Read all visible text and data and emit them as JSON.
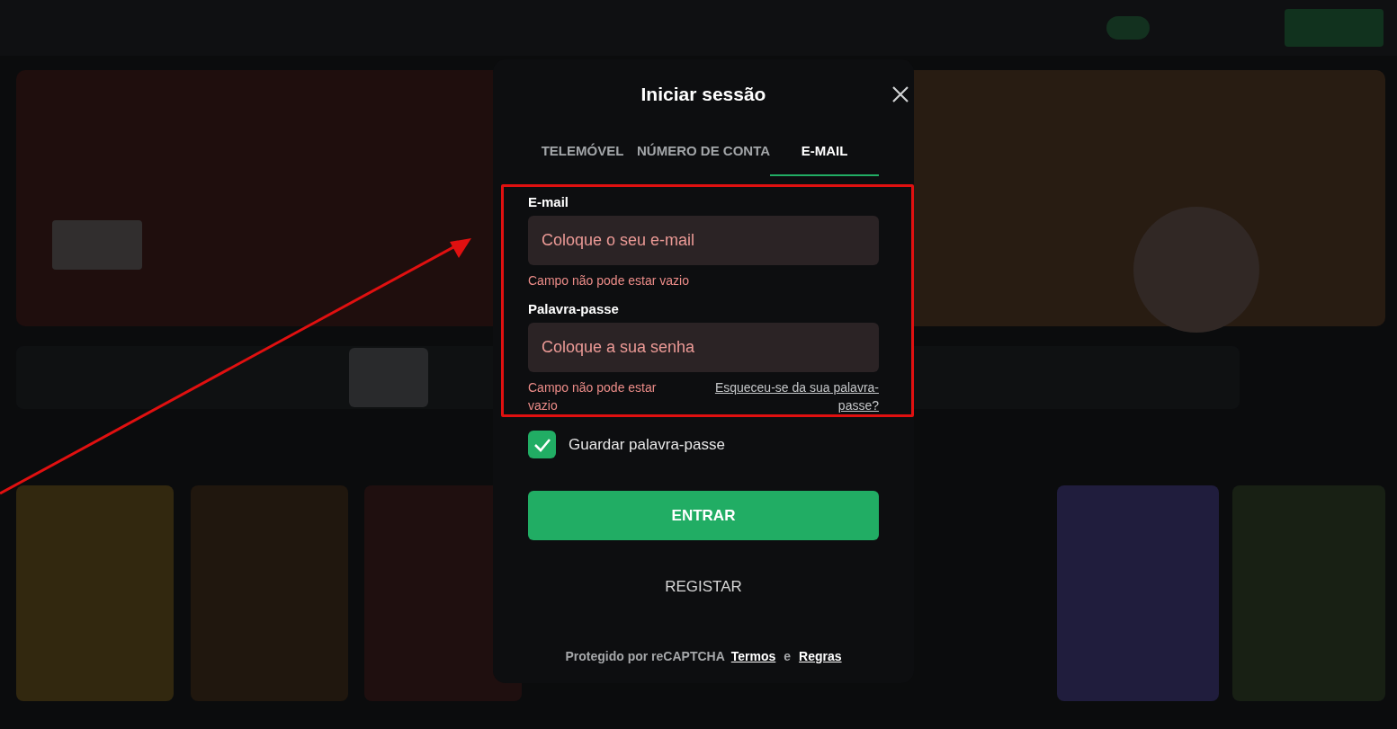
{
  "dialog": {
    "title": "Iniciar sessão",
    "tabs": [
      {
        "label": "TELEMÓVEL",
        "selected": false
      },
      {
        "label": "NÚMERO DE CONTA",
        "selected": false
      },
      {
        "label": "E-MAIL",
        "selected": true
      }
    ],
    "fields": [
      {
        "label": "E-mail",
        "placeholder": "Coloque o seu e-mail",
        "error": "Campo não pode estar vazio"
      },
      {
        "label": "Palavra-passe",
        "placeholder": "Coloque a sua senha",
        "error": "Campo não pode estar vazio",
        "link": "Esqueceu-se da sua palavra-passe?"
      }
    ],
    "remember": {
      "label": "Guardar palavra-passe",
      "checked": true
    },
    "submit": "ENTRAR",
    "register": "REGISTAR",
    "footer": {
      "text": "Protegido por reCAPTCHA",
      "terms": "Termos",
      "joiner": "e",
      "rules": "Regras"
    }
  },
  "annotation": {
    "highlight": true,
    "arrow": true
  }
}
